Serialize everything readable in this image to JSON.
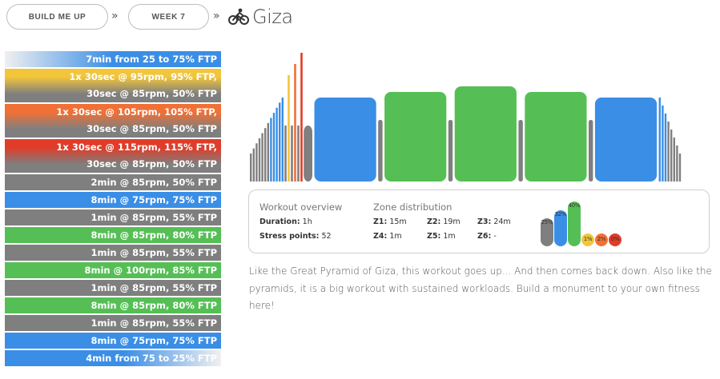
{
  "breadcrumb": {
    "plan_label": "BUILD ME UP",
    "week_label": "WEEK 7",
    "separator": "»",
    "workout_title": "Giza"
  },
  "icons": {
    "title_icon": "cyclist-icon"
  },
  "colors": {
    "z1": "#7f7f7f",
    "z2": "#3a8ee6",
    "z3": "#55bf55",
    "z4": "#f2c53b",
    "z5": "#f07035",
    "z6": "#e03c28"
  },
  "segments": [
    {
      "lines": [
        "7min from 25 to 75% FTP"
      ],
      "zone": "ramp-up"
    },
    {
      "lines": [
        "1x 30sec @ 95rpm, 95% FTP,",
        "30sec @ 85rpm, 50% FTP"
      ],
      "zone": "z4"
    },
    {
      "lines": [
        "1x 30sec @ 105rpm, 105% FTP,",
        "30sec @ 85rpm, 50% FTP"
      ],
      "zone": "z5"
    },
    {
      "lines": [
        "1x 30sec @ 115rpm, 115% FTP,",
        "30sec @ 85rpm, 50% FTP"
      ],
      "zone": "z6"
    },
    {
      "lines": [
        "2min @ 85rpm, 50% FTP"
      ],
      "zone": "z1"
    },
    {
      "lines": [
        "8min @ 75rpm, 75% FTP"
      ],
      "zone": "z2"
    },
    {
      "lines": [
        "1min @ 85rpm, 55% FTP"
      ],
      "zone": "z1"
    },
    {
      "lines": [
        "8min @ 85rpm, 80% FTP"
      ],
      "zone": "z3"
    },
    {
      "lines": [
        "1min @ 85rpm, 55% FTP"
      ],
      "zone": "z1"
    },
    {
      "lines": [
        "8min @ 100rpm, 85% FTP"
      ],
      "zone": "z3"
    },
    {
      "lines": [
        "1min @ 85rpm, 55% FTP"
      ],
      "zone": "z1"
    },
    {
      "lines": [
        "8min @ 85rpm, 80% FTP"
      ],
      "zone": "z3"
    },
    {
      "lines": [
        "1min @ 85rpm, 55% FTP"
      ],
      "zone": "z1"
    },
    {
      "lines": [
        "8min @ 75rpm, 75% FTP"
      ],
      "zone": "z2"
    },
    {
      "lines": [
        "4min from 75 to 25% FTP"
      ],
      "zone": "ramp-down"
    }
  ],
  "profile": {
    "warmup_ramp": {
      "count": 12,
      "from_ftp": 25,
      "to_ftp": 75
    },
    "intervals": [
      {
        "on_ftp": 95,
        "off_ftp": 50,
        "zone": "z4"
      },
      {
        "on_ftp": 105,
        "off_ftp": 50,
        "zone": "z5"
      },
      {
        "on_ftp": 115,
        "off_ftp": 50,
        "zone": "z6"
      }
    ],
    "blocks": [
      {
        "ftp": 50,
        "min": 2,
        "zone": "z1"
      },
      {
        "ftp": 75,
        "min": 8,
        "zone": "z2"
      },
      {
        "ftp": 55,
        "min": 1,
        "zone": "z1"
      },
      {
        "ftp": 80,
        "min": 8,
        "zone": "z3"
      },
      {
        "ftp": 55,
        "min": 1,
        "zone": "z1"
      },
      {
        "ftp": 85,
        "min": 8,
        "zone": "z3"
      },
      {
        "ftp": 55,
        "min": 1,
        "zone": "z1"
      },
      {
        "ftp": 80,
        "min": 8,
        "zone": "z3"
      },
      {
        "ftp": 55,
        "min": 1,
        "zone": "z1"
      },
      {
        "ftp": 75,
        "min": 8,
        "zone": "z2"
      }
    ],
    "cooldown_ramp": {
      "count": 8,
      "from_ftp": 75,
      "to_ftp": 25
    }
  },
  "overview": {
    "heading": "Workout overview",
    "duration_label": "Duration:",
    "duration_value": "1h",
    "stress_label": "Stress points:",
    "stress_value": "52"
  },
  "zones": {
    "heading": "Zone distribution",
    "items": [
      {
        "label": "Z1:",
        "value": "15m"
      },
      {
        "label": "Z2:",
        "value": "19m"
      },
      {
        "label": "Z3:",
        "value": "24m"
      },
      {
        "label": "Z4:",
        "value": "1m"
      },
      {
        "label": "Z5:",
        "value": "1m"
      },
      {
        "label": "Z6:",
        "value": "-"
      }
    ],
    "distribution": [
      {
        "zone": "z1",
        "pct_label": "25%",
        "pct": 25
      },
      {
        "zone": "z2",
        "pct_label": "32%",
        "pct": 32
      },
      {
        "zone": "z3",
        "pct_label": "40%",
        "pct": 40
      },
      {
        "zone": "z4",
        "pct_label": "1%",
        "pct": 1
      },
      {
        "zone": "z5",
        "pct_label": "2%",
        "pct": 2
      },
      {
        "zone": "z6",
        "pct_label": "0%",
        "pct": 0
      }
    ]
  },
  "description": "Like the Great Pyramid of Giza, this workout goes up... And then comes back down. Also like the pyramids, it is a big workout with sustained workloads. Build a monument to your own fitness here!"
}
